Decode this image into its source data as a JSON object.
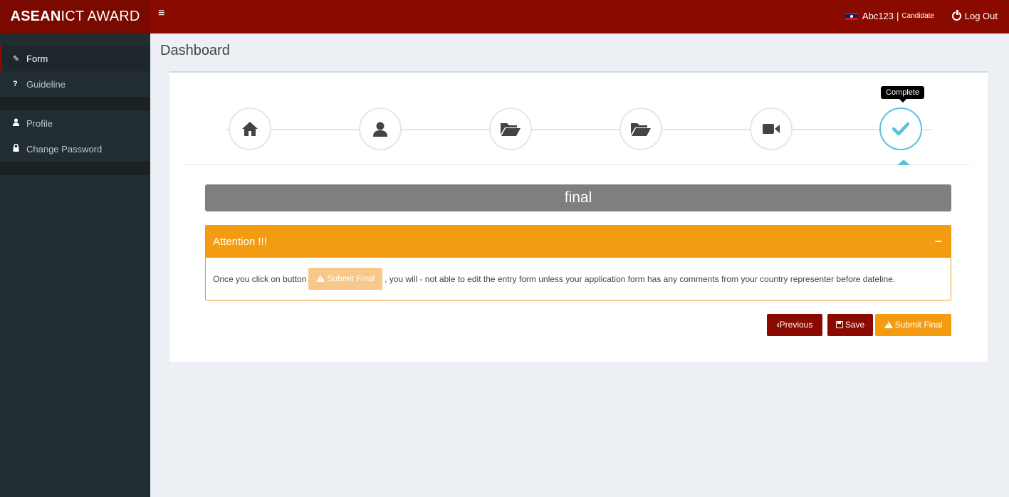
{
  "brand": {
    "bold": "ASEAN",
    "rest": "ICT AWARD"
  },
  "header": {
    "menu_icon": "hamburger-icon",
    "user_name": "Abc123",
    "separator": "|",
    "user_role": "Candidate",
    "logout_label": "Log Out",
    "logout_icon": "power-icon"
  },
  "sidebar": {
    "items": [
      {
        "label": "Form",
        "icon": "pencil-icon",
        "active": true
      },
      {
        "label": "Guideline",
        "icon": "question-icon",
        "active": false
      },
      {
        "label": "Profile",
        "icon": "user-icon",
        "active": false
      },
      {
        "label": "Change Password",
        "icon": "lock-icon",
        "active": false
      }
    ]
  },
  "page": {
    "title": "Dashboard"
  },
  "wizard": {
    "steps": [
      {
        "icon": "home-icon"
      },
      {
        "icon": "user-icon"
      },
      {
        "icon": "folder-open-icon"
      },
      {
        "icon": "folder-open-icon"
      },
      {
        "icon": "video-camera-icon"
      },
      {
        "icon": "check-icon",
        "active": true
      }
    ],
    "tooltip": "Complete"
  },
  "stage": {
    "title": "final"
  },
  "attention": {
    "title": "Attention !!!",
    "collapse_symbol": "−",
    "text_before": "Once you click on button",
    "inline_button": "Submit Final",
    "text_after": ", you will - not able to edit the entry form unless your application form has any comments from your country representer before dateline."
  },
  "actions": {
    "previous": "Previous",
    "save": "Save",
    "submit": "Submit Final"
  },
  "colors": {
    "brand": "#8b0a00",
    "warning": "#f39c12",
    "info": "#5bc0de",
    "sidebar": "#222d32"
  }
}
